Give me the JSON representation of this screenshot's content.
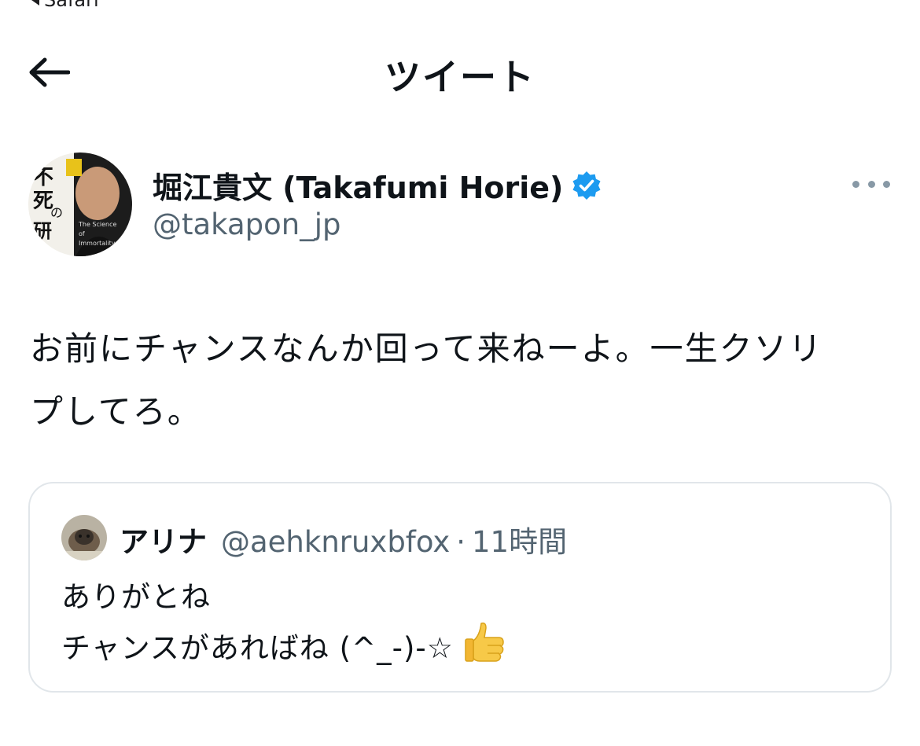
{
  "status_bar": {
    "back_label": "Safari"
  },
  "header": {
    "title": "ツイート"
  },
  "tweet": {
    "author_name": "堀江貴文 (Takafumi Horie)",
    "author_handle": "@takapon_jp",
    "verified": true,
    "text_line1": "お前にチャンスなんか回って来ねーよ。一生クソリ",
    "text_line2": "プしてろ。",
    "avatar_cover_text": "不死の研究",
    "avatar_cover_subtitle": "The Science of Immortality"
  },
  "quoted_tweet": {
    "author_name": "アリナ",
    "author_handle": "@aehknruxbfox",
    "separator": "·",
    "time": "11時間",
    "text_line1": "ありがとね",
    "text_line2": "チャンスがあればね (^_-)-☆"
  },
  "colors": {
    "primary_text": "#0f1419",
    "secondary_text": "#536471",
    "verified_blue": "#1d9bf0",
    "border": "#e1e6ea"
  }
}
